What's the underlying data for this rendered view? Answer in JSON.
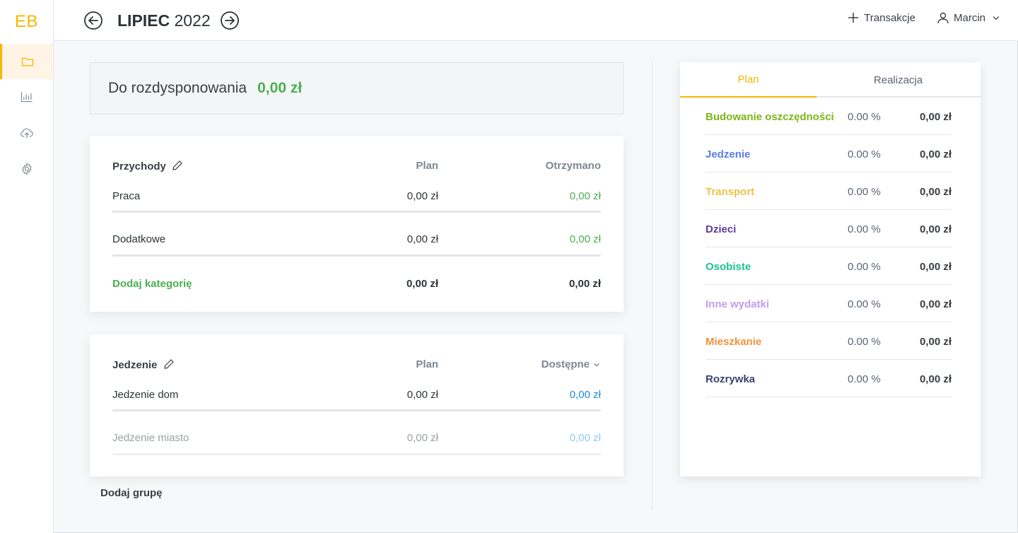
{
  "app": {
    "logo": "EB"
  },
  "sidebar": {
    "items": [
      {
        "icon": "folder-icon",
        "active": true
      },
      {
        "icon": "bar-chart-icon",
        "active": false
      },
      {
        "icon": "cloud-upload-icon",
        "active": false
      },
      {
        "icon": "gear-icon",
        "active": false
      }
    ]
  },
  "header": {
    "month_bold": "LIPIEC",
    "year": "2022",
    "transactions_label": "Transakcje",
    "user_name": "Marcin"
  },
  "summary": {
    "label": "Do rozdysponowania",
    "value": "0,00 zł"
  },
  "income_group": {
    "title": "Przychody",
    "col_plan": "Plan",
    "col_real": "Otrzymano",
    "rows": [
      {
        "name": "Praca",
        "plan": "0,00 zł",
        "real": "0,00 zł"
      },
      {
        "name": "Dodatkowe",
        "plan": "0,00 zł",
        "real": "0,00 zł"
      }
    ],
    "add_label": "Dodaj kategorię",
    "total_plan": "0,00 zł",
    "total_real": "0,00 zł"
  },
  "food_group": {
    "title": "Jedzenie",
    "col_plan": "Plan",
    "col_real": "Dostępne",
    "rows": [
      {
        "name": "Jedzenie dom",
        "plan": "0,00 zł",
        "real": "0,00 zł"
      },
      {
        "name": "Jedzenie miasto",
        "plan": "0,00 zł",
        "real": "0,00 zł"
      }
    ]
  },
  "add_group_label": "Dodaj grupę",
  "panel": {
    "tabs": [
      {
        "label": "Plan",
        "active": true
      },
      {
        "label": "Realizacja",
        "active": false
      }
    ],
    "rows": [
      {
        "name": "Budowanie oszczędności",
        "pct": "0.00 %",
        "value": "0,00 zł",
        "color": "#7cb518"
      },
      {
        "name": "Jedzenie",
        "pct": "0.00 %",
        "value": "0,00 zł",
        "color": "#5b7de8"
      },
      {
        "name": "Transport",
        "pct": "0.00 %",
        "value": "0,00 zł",
        "color": "#e8c547"
      },
      {
        "name": "Dzieci",
        "pct": "0.00 %",
        "value": "0,00 zł",
        "color": "#5e3a9e"
      },
      {
        "name": "Osobiste",
        "pct": "0.00 %",
        "value": "0,00 zł",
        "color": "#1fc28a"
      },
      {
        "name": "Inne wydatki",
        "pct": "0.00 %",
        "value": "0,00 zł",
        "color": "#c39bef"
      },
      {
        "name": "Mieszkanie",
        "pct": "0.00 %",
        "value": "0,00 zł",
        "color": "#f2923a"
      },
      {
        "name": "Rozrywka",
        "pct": "0.00 %",
        "value": "0,00 zł",
        "color": "#3a4470"
      }
    ]
  },
  "colors": {
    "accent": "#f5b800",
    "green": "#4caf50",
    "blue": "#1e88e5"
  }
}
